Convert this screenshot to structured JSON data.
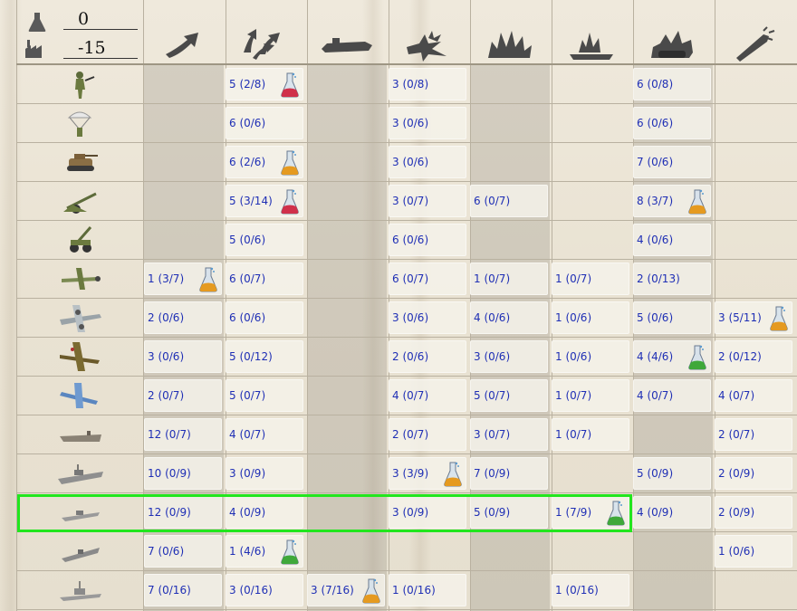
{
  "resources": {
    "top_value": "0",
    "bottom_value": "-15",
    "top_icon": "resource-flask-icon",
    "bottom_icon": "factory-icon"
  },
  "columns": [
    {
      "icon": "arrow-up-icon"
    },
    {
      "icon": "multi-arrows-icon"
    },
    {
      "icon": "submarine-icon"
    },
    {
      "icon": "air-explosion-icon"
    },
    {
      "icon": "ground-explosion-icon"
    },
    {
      "icon": "ship-explosion-icon"
    },
    {
      "icon": "tank-explosion-icon"
    },
    {
      "icon": "rocket-icon"
    }
  ],
  "rows": [
    {
      "unit": "infantry-icon",
      "cells": [
        null,
        {
          "text": "5 (2/8)",
          "flask": "red"
        },
        null,
        {
          "text": "3 (0/8)"
        },
        null,
        null,
        {
          "text": "6 (0/8)"
        },
        null
      ]
    },
    {
      "unit": "paratrooper-icon",
      "cells": [
        null,
        {
          "text": "6 (0/6)"
        },
        null,
        {
          "text": "3 (0/6)"
        },
        null,
        null,
        {
          "text": "6 (0/6)"
        },
        null
      ]
    },
    {
      "unit": "tank-icon",
      "cells": [
        null,
        {
          "text": "6 (2/6)",
          "flask": "orange"
        },
        null,
        {
          "text": "3 (0/6)"
        },
        null,
        null,
        {
          "text": "7 (0/6)"
        },
        null
      ]
    },
    {
      "unit": "artillery-icon",
      "cells": [
        null,
        {
          "text": "5 (3/14)",
          "flask": "red"
        },
        null,
        {
          "text": "3 (0/7)"
        },
        {
          "text": "6 (0/7)"
        },
        null,
        {
          "text": "8 (3/7)",
          "flask": "orange"
        },
        null
      ]
    },
    {
      "unit": "anti-air-gun-icon",
      "cells": [
        null,
        {
          "text": "5 (0/6)"
        },
        null,
        {
          "text": "6 (0/6)"
        },
        null,
        null,
        {
          "text": "4 (0/6)"
        },
        null
      ]
    },
    {
      "unit": "fighter-plane-icon",
      "cells": [
        {
          "text": "1 (3/7)",
          "flask": "orange"
        },
        {
          "text": "6 (0/7)"
        },
        null,
        {
          "text": "6 (0/7)"
        },
        {
          "text": "1 (0/7)"
        },
        {
          "text": "1 (0/7)"
        },
        {
          "text": "2 (0/13)"
        },
        null
      ]
    },
    {
      "unit": "bomber-plane-icon",
      "cells": [
        {
          "text": "2 (0/6)"
        },
        {
          "text": "6 (0/6)"
        },
        null,
        {
          "text": "3 (0/6)"
        },
        {
          "text": "4 (0/6)"
        },
        {
          "text": "1 (0/6)"
        },
        {
          "text": "5 (0/6)"
        },
        {
          "text": "3 (5/11)",
          "flask": "orange"
        }
      ]
    },
    {
      "unit": "heavy-bomber-icon",
      "cells": [
        {
          "text": "3 (0/6)"
        },
        {
          "text": "5 (0/12)"
        },
        null,
        {
          "text": "2 (0/6)"
        },
        {
          "text": "3 (0/6)"
        },
        {
          "text": "1 (0/6)"
        },
        {
          "text": "4 (4/6)",
          "flask": "green"
        },
        {
          "text": "2 (0/12)"
        }
      ]
    },
    {
      "unit": "naval-fighter-icon",
      "cells": [
        {
          "text": "2 (0/7)"
        },
        {
          "text": "5 (0/7)"
        },
        null,
        {
          "text": "4 (0/7)"
        },
        {
          "text": "5 (0/7)"
        },
        {
          "text": "1 (0/7)"
        },
        {
          "text": "4 (0/7)"
        },
        {
          "text": "4 (0/7)"
        }
      ]
    },
    {
      "unit": "carrier-icon",
      "cells": [
        {
          "text": "12 (0/7)"
        },
        {
          "text": "4 (0/7)"
        },
        null,
        {
          "text": "2 (0/7)"
        },
        {
          "text": "3 (0/7)"
        },
        {
          "text": "1 (0/7)"
        },
        null,
        {
          "text": "2 (0/7)"
        }
      ]
    },
    {
      "unit": "battleship-icon",
      "cells": [
        {
          "text": "10 (0/9)"
        },
        {
          "text": "3 (0/9)"
        },
        null,
        {
          "text": "3 (3/9)",
          "flask": "orange"
        },
        {
          "text": "7 (0/9)"
        },
        null,
        {
          "text": "5 (0/9)"
        },
        {
          "text": "2 (0/9)"
        }
      ]
    },
    {
      "unit": "cruiser-icon",
      "cells": [
        {
          "text": "12 (0/9)"
        },
        {
          "text": "4 (0/9)"
        },
        null,
        {
          "text": "3 (0/9)"
        },
        {
          "text": "5 (0/9)"
        },
        {
          "text": "1 (7/9)",
          "flask": "green"
        },
        {
          "text": "4 (0/9)"
        },
        {
          "text": "2 (0/9)"
        }
      ]
    },
    {
      "unit": "destroyer-icon",
      "cells": [
        {
          "text": "7 (0/6)"
        },
        {
          "text": "1 (4/6)",
          "flask": "green"
        },
        null,
        null,
        null,
        null,
        null,
        {
          "text": "1 (0/6)"
        }
      ]
    },
    {
      "unit": "frigate-icon",
      "cells": [
        {
          "text": "7 (0/16)"
        },
        {
          "text": "3 (0/16)"
        },
        {
          "text": "3 (7/16)",
          "flask": "orange"
        },
        {
          "text": "1 (0/16)"
        },
        null,
        {
          "text": "1 (0/16)"
        },
        null,
        null
      ]
    }
  ],
  "selected_row": 11,
  "colors": {
    "selection": "#22e61e",
    "value_text": "#1f2fb5"
  }
}
